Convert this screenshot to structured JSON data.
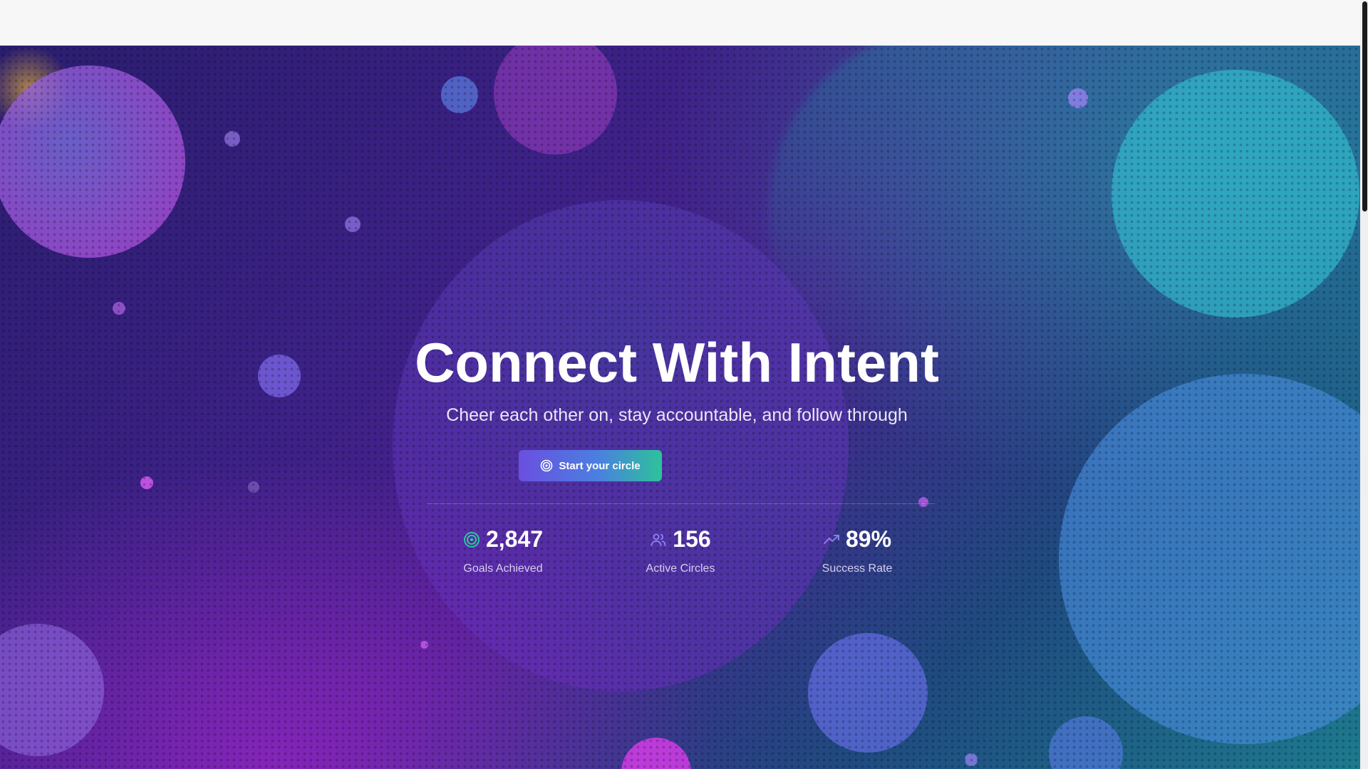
{
  "hero": {
    "headline": "Connect With Intent",
    "subheadline": "Cheer each other on, stay accountable, and follow through",
    "cta_label": "Start your circle",
    "cta_icon": "target-icon"
  },
  "stats": [
    {
      "value": "2,847",
      "label": "Goals Achieved",
      "icon": "target-icon",
      "color": "#2ec4a0"
    },
    {
      "value": "156",
      "label": "Active Circles",
      "icon": "users-icon",
      "color": "#8b7cf0"
    },
    {
      "value": "89%",
      "label": "Success Rate",
      "icon": "trending-up-icon",
      "color": "#8b7cf0"
    }
  ],
  "colors": {
    "accent_purple": "#6a4fe0",
    "accent_green": "#2cc39a",
    "bg_purple": "#3b2185",
    "bg_teal": "#1d7a8f"
  }
}
